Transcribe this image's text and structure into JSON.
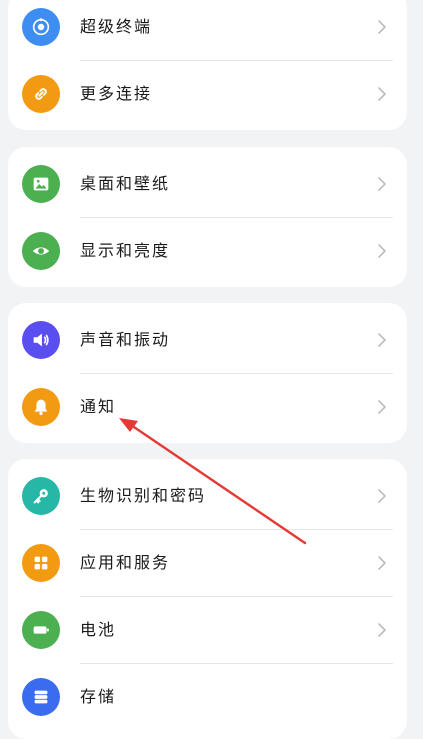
{
  "colors": {
    "page_bg": "#f1f3f5",
    "card_bg": "#ffffff",
    "annotation_arrow": "#e53935"
  },
  "groups": [
    {
      "items": [
        {
          "label": "超级终端",
          "icon": "super-device-icon",
          "color": "#3d8ef0"
        },
        {
          "label": "更多连接",
          "icon": "link-icon",
          "color": "#f29a12"
        }
      ]
    },
    {
      "items": [
        {
          "label": "桌面和壁纸",
          "icon": "wallpaper-icon",
          "color": "#4caf50"
        },
        {
          "label": "显示和亮度",
          "icon": "eye-icon",
          "color": "#4caf50"
        }
      ]
    },
    {
      "items": [
        {
          "label": "声音和振动",
          "icon": "speaker-icon",
          "color": "#5b4ef0"
        },
        {
          "label": "通知",
          "icon": "bell-icon",
          "color": "#f29a12"
        }
      ]
    },
    {
      "items": [
        {
          "label": "生物识别和密码",
          "icon": "key-icon",
          "color": "#26b7a7"
        },
        {
          "label": "应用和服务",
          "icon": "apps-grid-icon",
          "color": "#f29a12"
        },
        {
          "label": "电池",
          "icon": "battery-icon",
          "color": "#4caf50"
        },
        {
          "label": "存储",
          "icon": "storage-icon",
          "color": "#3b6cf0"
        }
      ]
    }
  ]
}
